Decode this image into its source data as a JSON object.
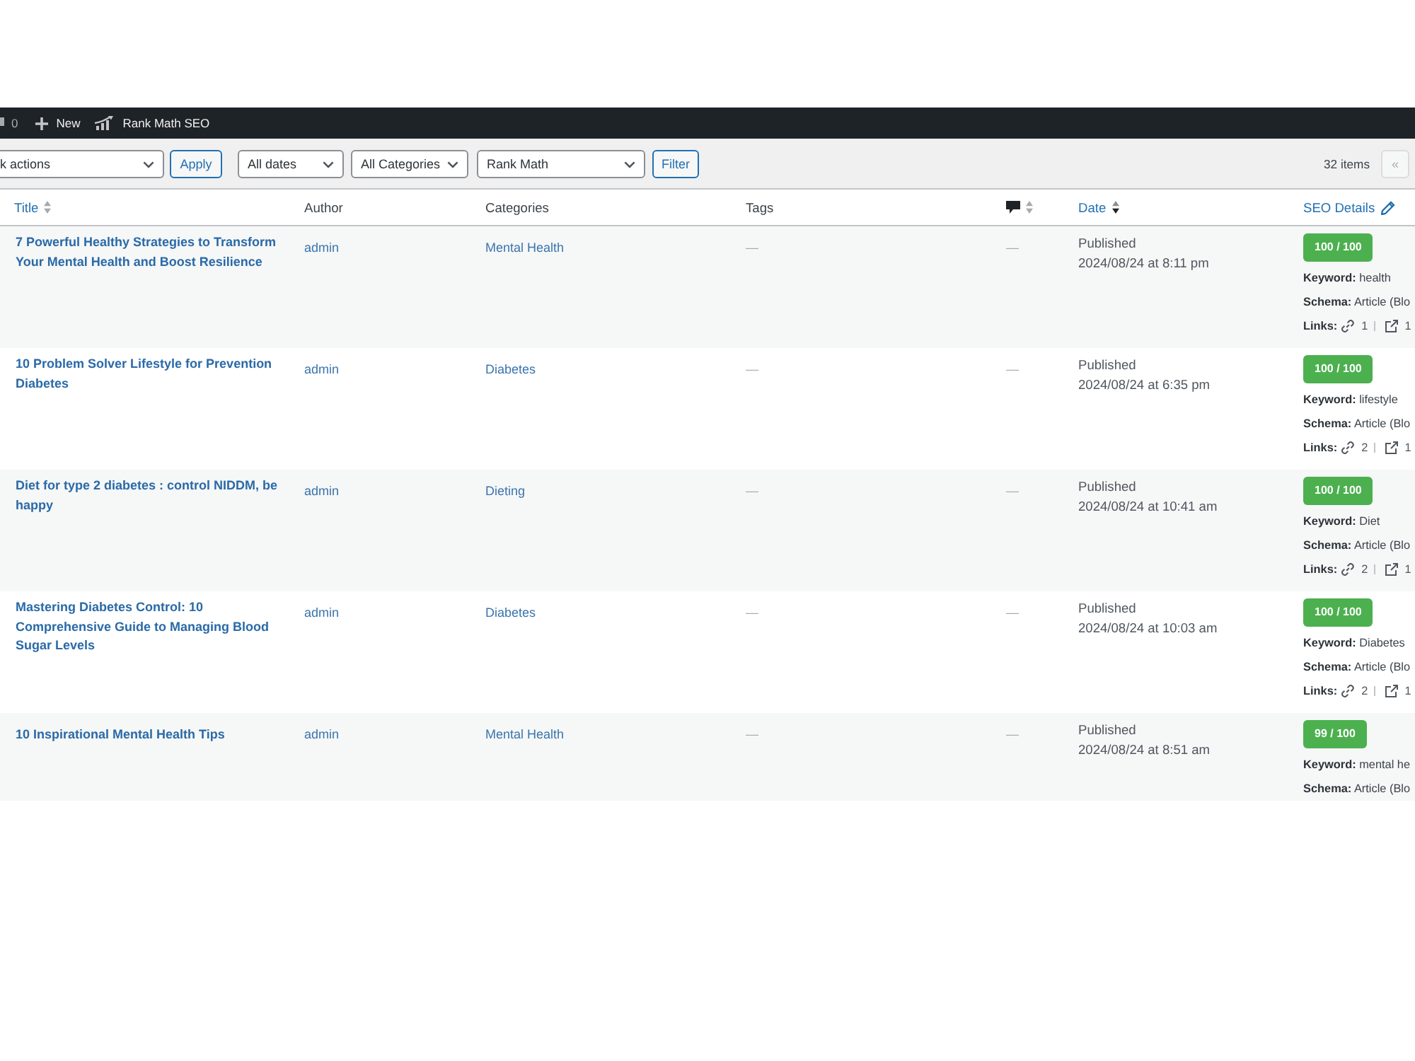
{
  "admin_bar": {
    "comments_count": "0",
    "new_label": "New",
    "plugin_label": "Rank Math SEO"
  },
  "toolbar": {
    "bulk_actions": "k actions",
    "apply_button": "Apply",
    "filters": [
      {
        "label": "All dates"
      },
      {
        "label": "All Categories"
      },
      {
        "label": "Rank Math"
      }
    ],
    "filter_button": "Filter",
    "item_count": "32 items",
    "pagination": [
      {
        "label": "«",
        "disabled": true
      }
    ]
  },
  "table": {
    "columns": [
      {
        "kind": "text",
        "label": "Title",
        "link": true,
        "sortable": true,
        "sorted": false
      },
      {
        "kind": "text",
        "label": "Author",
        "link": false,
        "sortable": false,
        "sorted": false
      },
      {
        "kind": "text",
        "label": "Categories",
        "link": false,
        "sortable": false,
        "sorted": false
      },
      {
        "kind": "text",
        "label": "Tags",
        "link": false,
        "sortable": false,
        "sorted": false
      },
      {
        "kind": "icon",
        "sortable": true,
        "sorted": false
      },
      {
        "kind": "text",
        "label": "Date",
        "link": true,
        "sortable": true,
        "sorted": true
      },
      {
        "kind": "text",
        "label": "SEO Details",
        "link": true,
        "sortable": false,
        "sorted": false,
        "edit_icon": true
      }
    ],
    "rows": [
      {
        "title": "7 Powerful Healthy Strategies to Transform Your Mental Health and Boost Resilience",
        "author": "admin",
        "categories": "Mental Health",
        "tags": "—",
        "comments": "—",
        "status": "Published",
        "date": "2024/08/24 at 8:11 pm",
        "seo": {
          "score": "100 / 100",
          "keyword": "**Keyword:** health",
          "schema": "**Schema:** Article (Blo",
          "links": {
            "label": "Links:",
            "internal": "1",
            "external": "1"
          }
        }
      },
      {
        "title": "10 Problem Solver Lifestyle for Prevention Diabetes",
        "author": "admin",
        "categories": "Diabetes",
        "tags": "—",
        "comments": "—",
        "status": "Published",
        "date": "2024/08/24 at 6:35 pm",
        "seo": {
          "score": "100 / 100",
          "keyword": "**Keyword:** lifestyle",
          "schema": "**Schema:** Article (Blo",
          "links": {
            "label": "Links:",
            "internal": "2",
            "external": "1"
          }
        }
      },
      {
        "title": "Diet for type 2 diabetes : control NIDDM, be happy",
        "author": "admin",
        "categories": "Dieting",
        "tags": "—",
        "comments": "—",
        "status": "Published",
        "date": "2024/08/24 at 10:41 am",
        "seo": {
          "score": "100 / 100",
          "keyword": "**Keyword:** Diet",
          "schema": "**Schema:** Article (Blo",
          "links": {
            "label": "Links:",
            "internal": "2",
            "external": "1"
          }
        }
      },
      {
        "title": "Mastering Diabetes Control: 10 Comprehensive Guide to Managing Blood Sugar Levels",
        "author": "admin",
        "categories": "Diabetes",
        "tags": "—",
        "comments": "—",
        "status": "Published",
        "date": "2024/08/24 at 10:03 am",
        "seo": {
          "score": "100 / 100",
          "keyword": "**Keyword:** Diabetes",
          "schema": "**Schema:** Article (Blo",
          "links": {
            "label": "Links:",
            "internal": "2",
            "external": "1"
          }
        }
      },
      {
        "title": "10 Inspirational Mental Health Tips",
        "author": "admin",
        "categories": "Mental Health",
        "tags": "—",
        "comments": "—",
        "status": "Published",
        "date": "2024/08/24 at 8:51 am",
        "seo": {
          "score": "99 / 100",
          "keyword": "**Keyword:** mental he",
          "schema": "**Schema:** Article (Blo"
        }
      }
    ]
  }
}
